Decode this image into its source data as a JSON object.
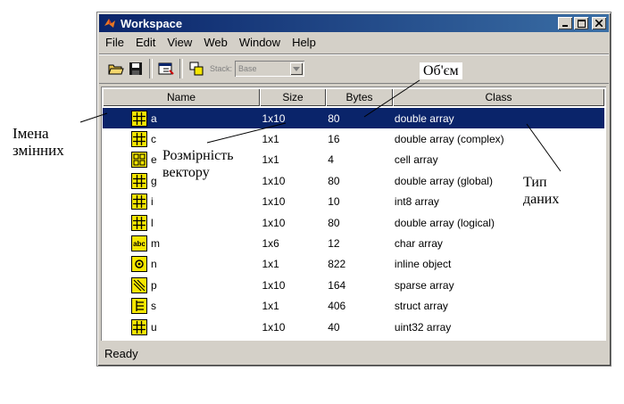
{
  "window": {
    "title": "Workspace",
    "status": "Ready"
  },
  "menu": {
    "items": [
      "File",
      "Edit",
      "View",
      "Web",
      "Window",
      "Help"
    ]
  },
  "toolbar": {
    "stack_label": "Stack:",
    "stack_value": "Base"
  },
  "table": {
    "columns": [
      "Name",
      "Size",
      "Bytes",
      "Class"
    ],
    "rows": [
      {
        "name": "a",
        "size": "1x10",
        "bytes": "80",
        "class": "double array",
        "icon": "double-array-icon",
        "selected": true
      },
      {
        "name": "c",
        "size": "1x1",
        "bytes": "16",
        "class": "double array (complex)",
        "icon": "double-array-icon",
        "selected": false
      },
      {
        "name": "e",
        "size": "1x1",
        "bytes": "4",
        "class": "cell array",
        "icon": "cell-array-icon",
        "selected": false
      },
      {
        "name": "g",
        "size": "1x10",
        "bytes": "80",
        "class": "double array (global)",
        "icon": "double-array-icon",
        "selected": false
      },
      {
        "name": "i",
        "size": "1x10",
        "bytes": "10",
        "class": "int8 array",
        "icon": "double-array-icon",
        "selected": false
      },
      {
        "name": "l",
        "size": "1x10",
        "bytes": "80",
        "class": "double array (logical)",
        "icon": "double-array-icon",
        "selected": false
      },
      {
        "name": "m",
        "size": "1x6",
        "bytes": "12",
        "class": "char array",
        "icon": "char-array-icon",
        "selected": false
      },
      {
        "name": "n",
        "size": "1x1",
        "bytes": "822",
        "class": "inline object",
        "icon": "inline-object-icon",
        "selected": false
      },
      {
        "name": "p",
        "size": "1x10",
        "bytes": "164",
        "class": "sparse array",
        "icon": "sparse-array-icon",
        "selected": false
      },
      {
        "name": "s",
        "size": "1x1",
        "bytes": "406",
        "class": "struct array",
        "icon": "struct-array-icon",
        "selected": false
      },
      {
        "name": "u",
        "size": "1x10",
        "bytes": "40",
        "class": "uint32 array",
        "icon": "double-array-icon",
        "selected": false
      }
    ]
  },
  "annotations": {
    "variable_names": [
      "Імена",
      "змінних"
    ],
    "dimension": [
      "Розмірність",
      "вектору"
    ],
    "volume": "Об'єм",
    "data_type": [
      "Тип",
      "даних"
    ]
  },
  "colors": {
    "titlebar": "#0a246a",
    "selection": "#0a246a",
    "chrome": "#d4d0c8",
    "icon_fill": "#f5e600"
  }
}
